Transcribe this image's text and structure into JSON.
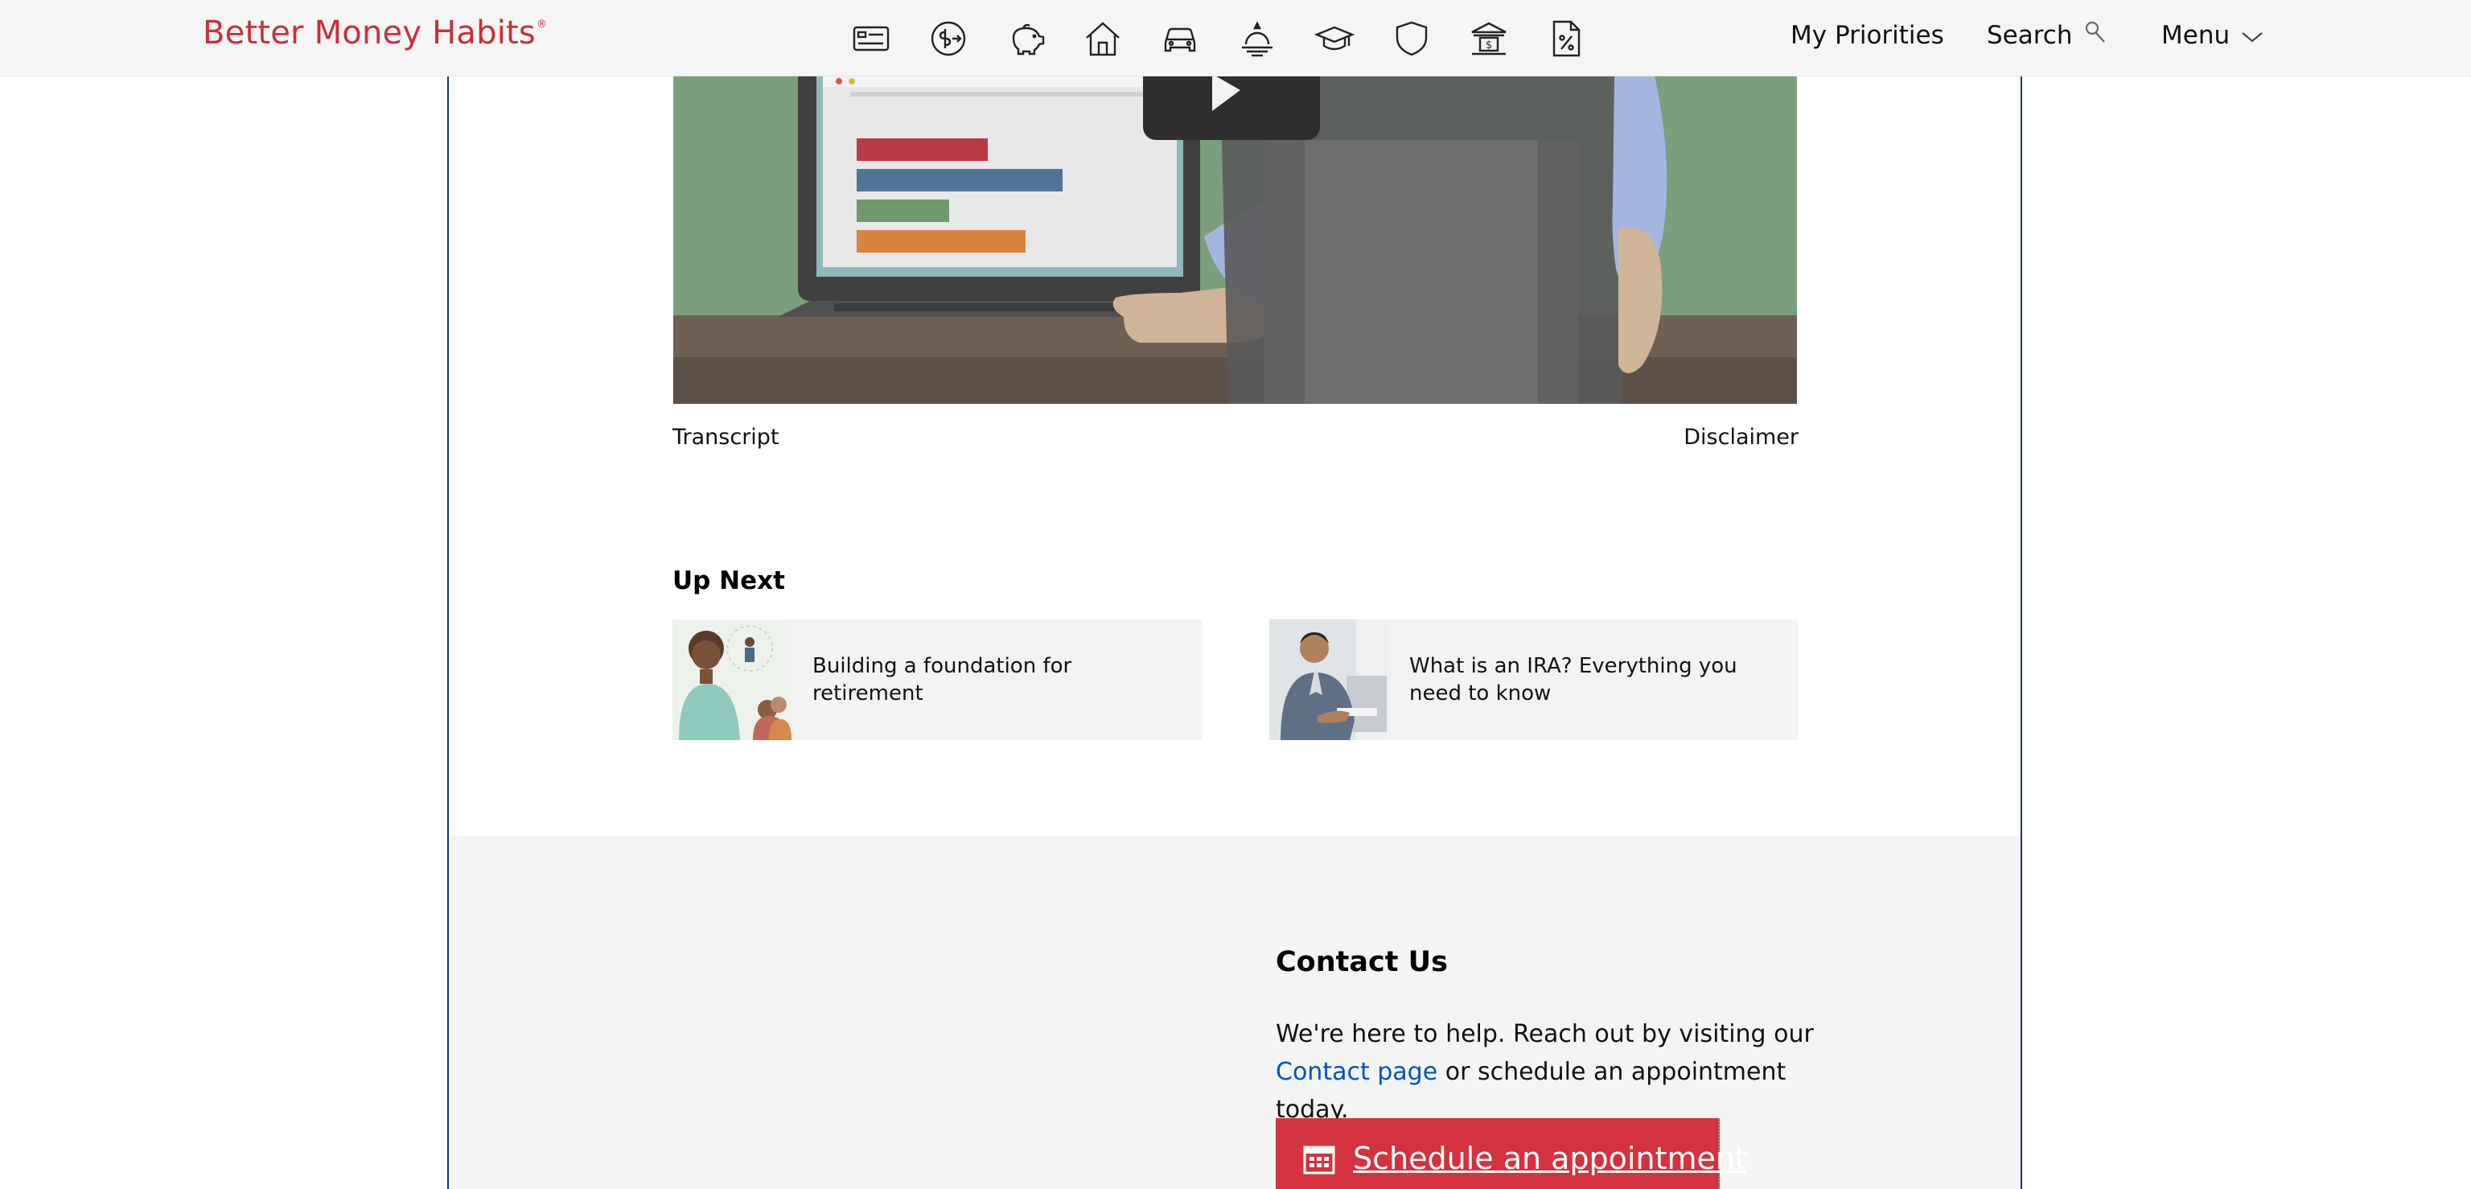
{
  "header": {
    "logo_text": "Better Money Habits",
    "logo_mark": "®",
    "icons": [
      {
        "name": "credit-card-icon"
      },
      {
        "name": "dollar-exchange-icon"
      },
      {
        "name": "piggy-bank-icon"
      },
      {
        "name": "house-icon"
      },
      {
        "name": "car-icon"
      },
      {
        "name": "sunset-icon"
      },
      {
        "name": "graduation-cap-icon"
      },
      {
        "name": "shield-icon"
      },
      {
        "name": "bank-icon"
      },
      {
        "name": "percent-document-icon"
      }
    ],
    "my_priorities": "My Priorities",
    "search": "Search",
    "menu": "Menu"
  },
  "video": {
    "transcript": "Transcript",
    "disclaimer": "Disclaimer"
  },
  "up_next": {
    "heading": "Up Next",
    "cards": [
      {
        "title": "Building a foundation for retirement"
      },
      {
        "title": "What is an IRA? Everything you need to know"
      }
    ]
  },
  "contact": {
    "heading": "Contact Us",
    "body_before": "We're here to help. Reach out by visiting our",
    "link_text": "Contact page",
    "body_after": "or schedule an appointment today.",
    "button_label": "Schedule an appointment"
  },
  "colors": {
    "brand_red": "#d3323e",
    "logo_red": "#c8303a",
    "link_blue": "#0052c2",
    "frame_navy": "#1f3566"
  }
}
